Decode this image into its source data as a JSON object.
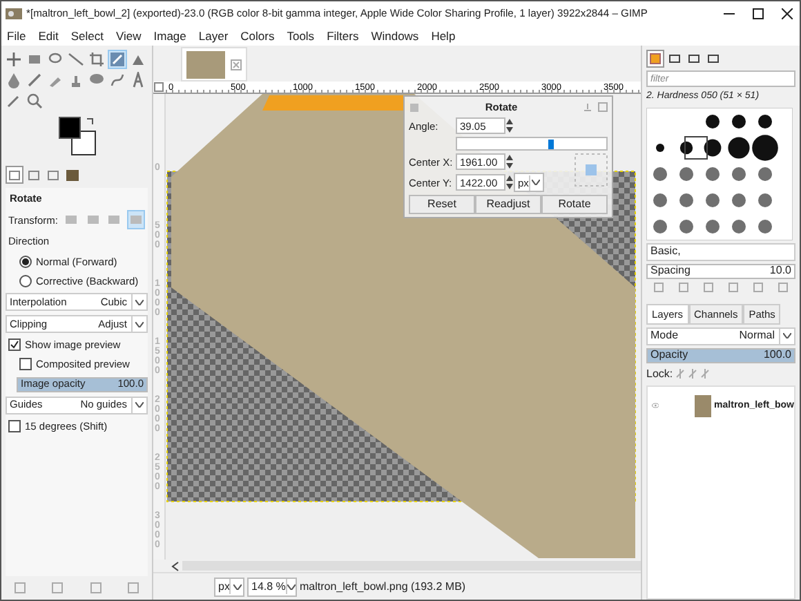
{
  "window": {
    "title": "*[maltron_left_bowl_2] (exported)-23.0 (RGB color 8-bit gamma integer, Apple Wide Color Sharing Profile, 1 layer) 3922x2844 – GIMP"
  },
  "menu": [
    "File",
    "Edit",
    "Select",
    "View",
    "Image",
    "Layer",
    "Colors",
    "Tools",
    "Filters",
    "Windows",
    "Help"
  ],
  "toolbox": {
    "tools": [
      {
        "selected": false
      },
      {
        "selected": false
      },
      {
        "selected": false
      },
      {
        "selected": false
      },
      {
        "selected": false
      },
      {
        "selected": true
      },
      {
        "selected": false
      },
      {
        "selected": false
      },
      {
        "selected": false
      },
      {
        "selected": false
      },
      {
        "selected": false
      },
      {
        "selected": false
      },
      {
        "selected": false
      },
      {
        "selected": false
      },
      {
        "selected": false
      },
      {
        "selected": false
      }
    ]
  },
  "tool_options": {
    "tabs": [
      {
        "selected": true
      },
      {
        "selected": false
      },
      {
        "selected": false
      },
      {
        "selected": false
      }
    ],
    "title": "Rotate",
    "transform_label": "Transform:",
    "transform_modes": [
      {
        "selected": false
      },
      {
        "selected": false
      },
      {
        "selected": false
      },
      {
        "selected": true
      }
    ],
    "direction_label": "Direction",
    "directions": [
      {
        "label": "Normal (Forward)",
        "selected": true
      },
      {
        "label": "Corrective (Backward)",
        "selected": false
      }
    ],
    "interpolation": {
      "label": "Interpolation",
      "value": "Cubic"
    },
    "clipping": {
      "label": "Clipping",
      "value": "Adjust"
    },
    "show_preview": {
      "label": "Show image preview",
      "checked": true
    },
    "composited_preview": {
      "label": "Composited preview",
      "checked": false
    },
    "image_opacity": {
      "label": "Image opacity",
      "value": "100.0",
      "level": 1
    },
    "guides": {
      "label": "Guides",
      "value": "No guides"
    },
    "fifteen_degrees": {
      "label": "15 degrees (Shift)",
      "checked": false
    }
  },
  "image_tabs": [
    {
      "selected": true
    }
  ],
  "rulers": {
    "horizontal": [
      "0",
      "500",
      "1000",
      "1500",
      "2000",
      "2500",
      "3000",
      "3500"
    ],
    "vertical": [
      "0",
      "500",
      "1000",
      "1500",
      "2000",
      "2500",
      "3000"
    ]
  },
  "rotate_dialog": {
    "title": "Rotate",
    "angle": {
      "label": "Angle:",
      "value": "39.05",
      "level": 0.61
    },
    "center_x": {
      "label": "Center X:",
      "value": "1961.00"
    },
    "center_y": {
      "label": "Center Y:",
      "value": "1422.00"
    },
    "unit": "px",
    "buttons": [
      "Reset",
      "Readjust",
      "Rotate"
    ]
  },
  "status_bar": {
    "unit": "px",
    "zoom": "14.8 %",
    "file": "maltron_left_bowl.png (193.2 MB)"
  },
  "brushes": {
    "tabs": [
      {
        "selected": true
      },
      {
        "selected": false
      },
      {
        "selected": false
      },
      {
        "selected": false
      }
    ],
    "filter_placeholder": "filter",
    "brush_name": "2. Hardness 050 (51 × 51)",
    "preset": "Basic,",
    "spacing": {
      "label": "Spacing",
      "value": "10.0"
    }
  },
  "layers": {
    "tabs": [
      {
        "label": "Layers",
        "selected": true
      },
      {
        "label": "Channels",
        "selected": false
      },
      {
        "label": "Paths",
        "selected": false
      }
    ],
    "mode": {
      "label": "Mode",
      "value": "Normal"
    },
    "opacity": {
      "label": "Opacity",
      "value": "100.0",
      "level": 1
    },
    "lock_label": "Lock:",
    "items": [
      {
        "name": "maltron_left_bow",
        "visible": true
      }
    ]
  }
}
